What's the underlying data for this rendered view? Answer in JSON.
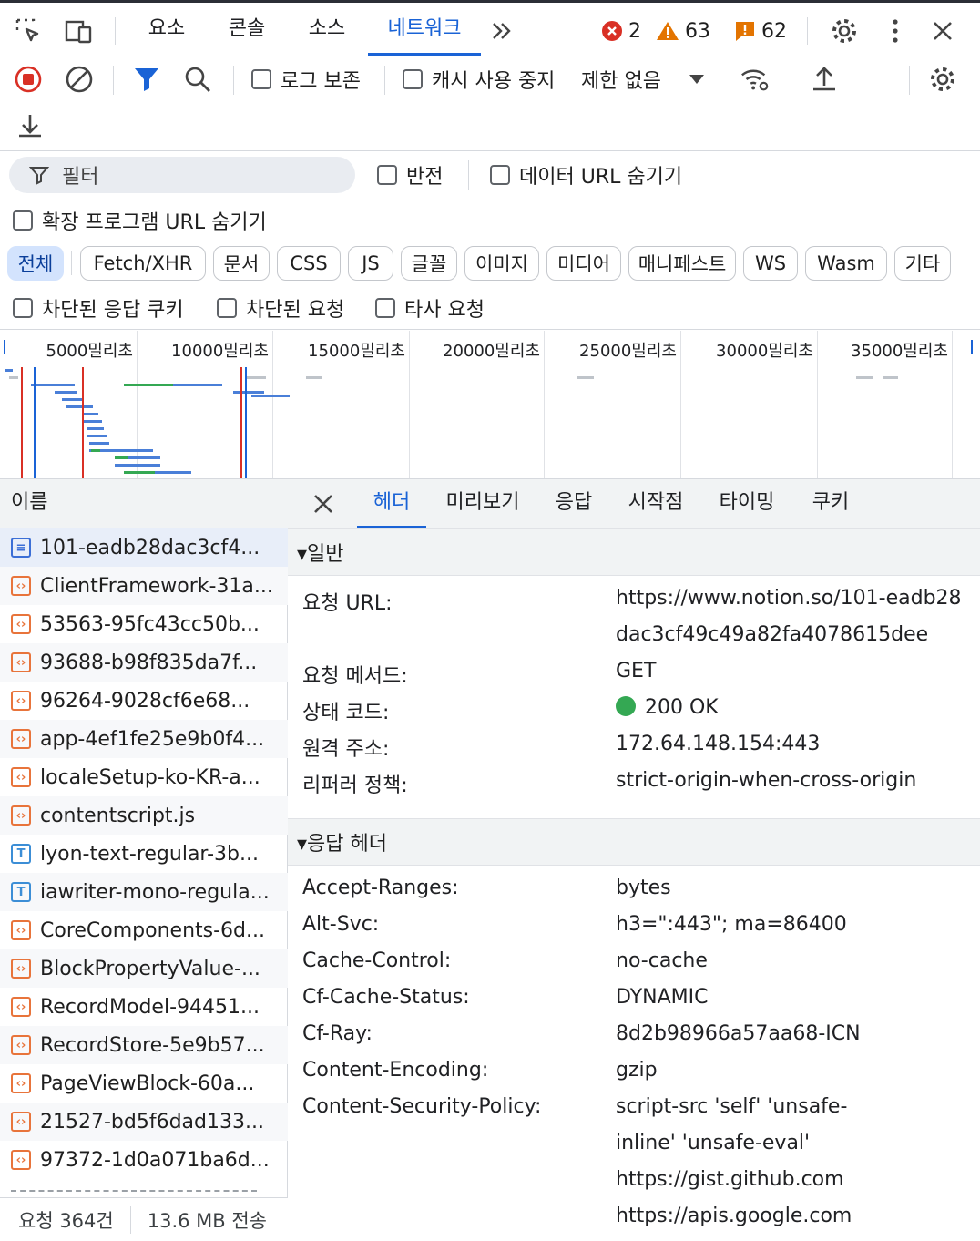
{
  "top_tabs": [
    "요소",
    "콘솔",
    "소스",
    "네트워크"
  ],
  "more_tabs_icon": "chevron-double-right-icon",
  "issues": {
    "errors": "2",
    "warnings": "63",
    "info": "62"
  },
  "toolbar": {
    "preserve_log": "로그 보존",
    "disable_cache": "캐시 사용 중지",
    "throttling": "제한 없음"
  },
  "filter": {
    "placeholder": "필터",
    "invert": "반전",
    "hide_data_urls": "데이터 URL 숨기기",
    "hide_extension_urls": "확장 프로그램 URL 숨기기",
    "types": [
      "전체",
      "Fetch/XHR",
      "문서",
      "CSS",
      "JS",
      "글꼴",
      "이미지",
      "미디어",
      "매니페스트",
      "WS",
      "Wasm",
      "기타"
    ],
    "blocked_cookies": "차단된 응답 쿠키",
    "blocked_requests": "차단된 요청",
    "third_party": "타사 요청"
  },
  "timeline": {
    "ticks": [
      "5000밀리초",
      "10000밀리초",
      "15000밀리초",
      "20000밀리초",
      "25000밀리초",
      "30000밀리초",
      "35000밀리초"
    ]
  },
  "requests": {
    "header": "이름",
    "rows": [
      {
        "name": "101-eadb28dac3cf4...",
        "type": "doc"
      },
      {
        "name": "ClientFramework-31a...",
        "type": "script"
      },
      {
        "name": "53563-95fc43cc50b...",
        "type": "script"
      },
      {
        "name": "93688-b98f835da7f...",
        "type": "script"
      },
      {
        "name": "96264-9028cf6e68...",
        "type": "script"
      },
      {
        "name": "app-4ef1fe25e9b0f4...",
        "type": "script"
      },
      {
        "name": "localeSetup-ko-KR-a...",
        "type": "script"
      },
      {
        "name": "contentscript.js",
        "type": "script"
      },
      {
        "name": "lyon-text-regular-3b...",
        "type": "font"
      },
      {
        "name": "iawriter-mono-regula...",
        "type": "font"
      },
      {
        "name": "CoreComponents-6d...",
        "type": "script"
      },
      {
        "name": "BlockPropertyValue-...",
        "type": "script"
      },
      {
        "name": "RecordModel-94451...",
        "type": "script"
      },
      {
        "name": "RecordStore-5e9b57...",
        "type": "script"
      },
      {
        "name": "PageViewBlock-60a...",
        "type": "script"
      },
      {
        "name": "21527-bd5f6dad133...",
        "type": "script"
      },
      {
        "name": "97372-1d0a071ba6d...",
        "type": "script"
      }
    ],
    "status_count": "요청 364건",
    "status_transfer": "13.6 MB 전송"
  },
  "detail": {
    "tabs": [
      "헤더",
      "미리보기",
      "응답",
      "시작점",
      "타이밍",
      "쿠키"
    ],
    "general_title": "▾일반",
    "general": [
      {
        "k": "요청 URL:",
        "v": [
          "https://www.notion.so/101-eadb28",
          "dac3cf49c49a82fa4078615dee"
        ]
      },
      {
        "k": "요청 메서드:",
        "v": [
          "GET"
        ]
      },
      {
        "k": "상태 코드:",
        "v": [
          "200 OK"
        ]
      },
      {
        "k": "원격 주소:",
        "v": [
          "172.64.148.154:443"
        ]
      },
      {
        "k": "리퍼러 정책:",
        "v": [
          "strict-origin-when-cross-origin"
        ]
      }
    ],
    "response_title": "▾응답 헤더",
    "response": [
      {
        "k": "Accept-Ranges:",
        "v": [
          "bytes"
        ]
      },
      {
        "k": "Alt-Svc:",
        "v": [
          "h3=\":443\"; ma=86400"
        ]
      },
      {
        "k": "Cache-Control:",
        "v": [
          "no-cache"
        ]
      },
      {
        "k": "Cf-Cache-Status:",
        "v": [
          "DYNAMIC"
        ]
      },
      {
        "k": "Cf-Ray:",
        "v": [
          "8d2b98966a57aa68-ICN"
        ]
      },
      {
        "k": "Content-Encoding:",
        "v": [
          "gzip"
        ]
      },
      {
        "k": "Content-Security-Policy:",
        "v": [
          "script-src 'self' 'unsafe-",
          "inline' 'unsafe-eval'",
          "https://gist.github.com",
          "https://apis.google.com"
        ]
      }
    ]
  },
  "colors": {
    "accent": "#1a63d6",
    "status_ok": "#34a853",
    "record": "#d93025",
    "error": "#d93025",
    "warning": "#e37400"
  }
}
